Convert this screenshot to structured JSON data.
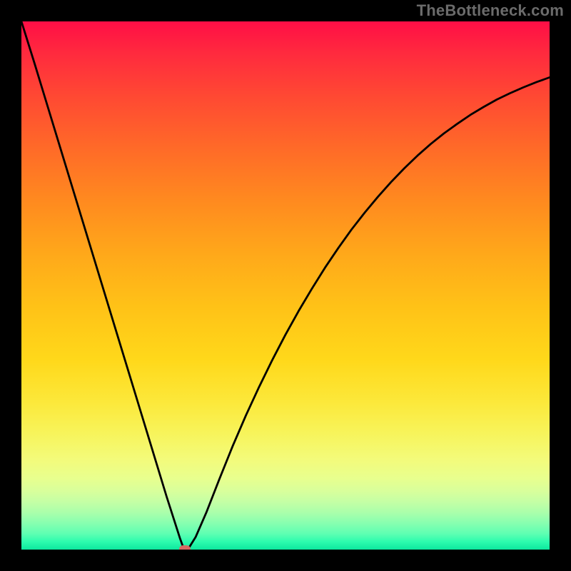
{
  "watermark": "TheBottleneck.com",
  "chart_data": {
    "type": "line",
    "title": "",
    "xlabel": "",
    "ylabel": "",
    "xlim": [
      0,
      100
    ],
    "ylim": [
      0,
      100
    ],
    "grid": false,
    "series": [
      {
        "name": "bottleneck-curve",
        "x": [
          0.0,
          2.5,
          5.0,
          7.5,
          10.0,
          12.5,
          15.0,
          17.5,
          20.0,
          22.5,
          25.0,
          27.5,
          30.0,
          30.5,
          31.0,
          31.5,
          32.0,
          33.0,
          35.0,
          37.5,
          40.0,
          42.5,
          45.0,
          47.5,
          50.0,
          52.5,
          55.0,
          57.5,
          60.0,
          62.5,
          65.0,
          67.5,
          70.0,
          72.5,
          75.0,
          77.5,
          80.0,
          82.5,
          85.0,
          87.5,
          90.0,
          92.5,
          95.0,
          97.5,
          100.0
        ],
        "y": [
          100.0,
          92.0,
          83.8,
          75.6,
          67.4,
          59.2,
          51.0,
          42.8,
          34.6,
          26.4,
          18.2,
          10.0,
          2.2,
          0.8,
          0.0,
          0.0,
          0.8,
          2.4,
          7.0,
          13.4,
          19.6,
          25.4,
          30.8,
          35.9,
          40.7,
          45.2,
          49.4,
          53.4,
          57.1,
          60.6,
          63.8,
          66.8,
          69.6,
          72.2,
          74.6,
          76.8,
          78.8,
          80.6,
          82.3,
          83.8,
          85.2,
          86.4,
          87.5,
          88.5,
          89.4
        ]
      }
    ],
    "marker": {
      "x": 31.0,
      "y": 0.0
    },
    "gradient_stops": [
      {
        "pos": 0.0,
        "color": "#ff0e46"
      },
      {
        "pos": 0.5,
        "color": "#ffc217"
      },
      {
        "pos": 0.8,
        "color": "#f3fb7b"
      },
      {
        "pos": 1.0,
        "color": "#0de79e"
      }
    ]
  }
}
